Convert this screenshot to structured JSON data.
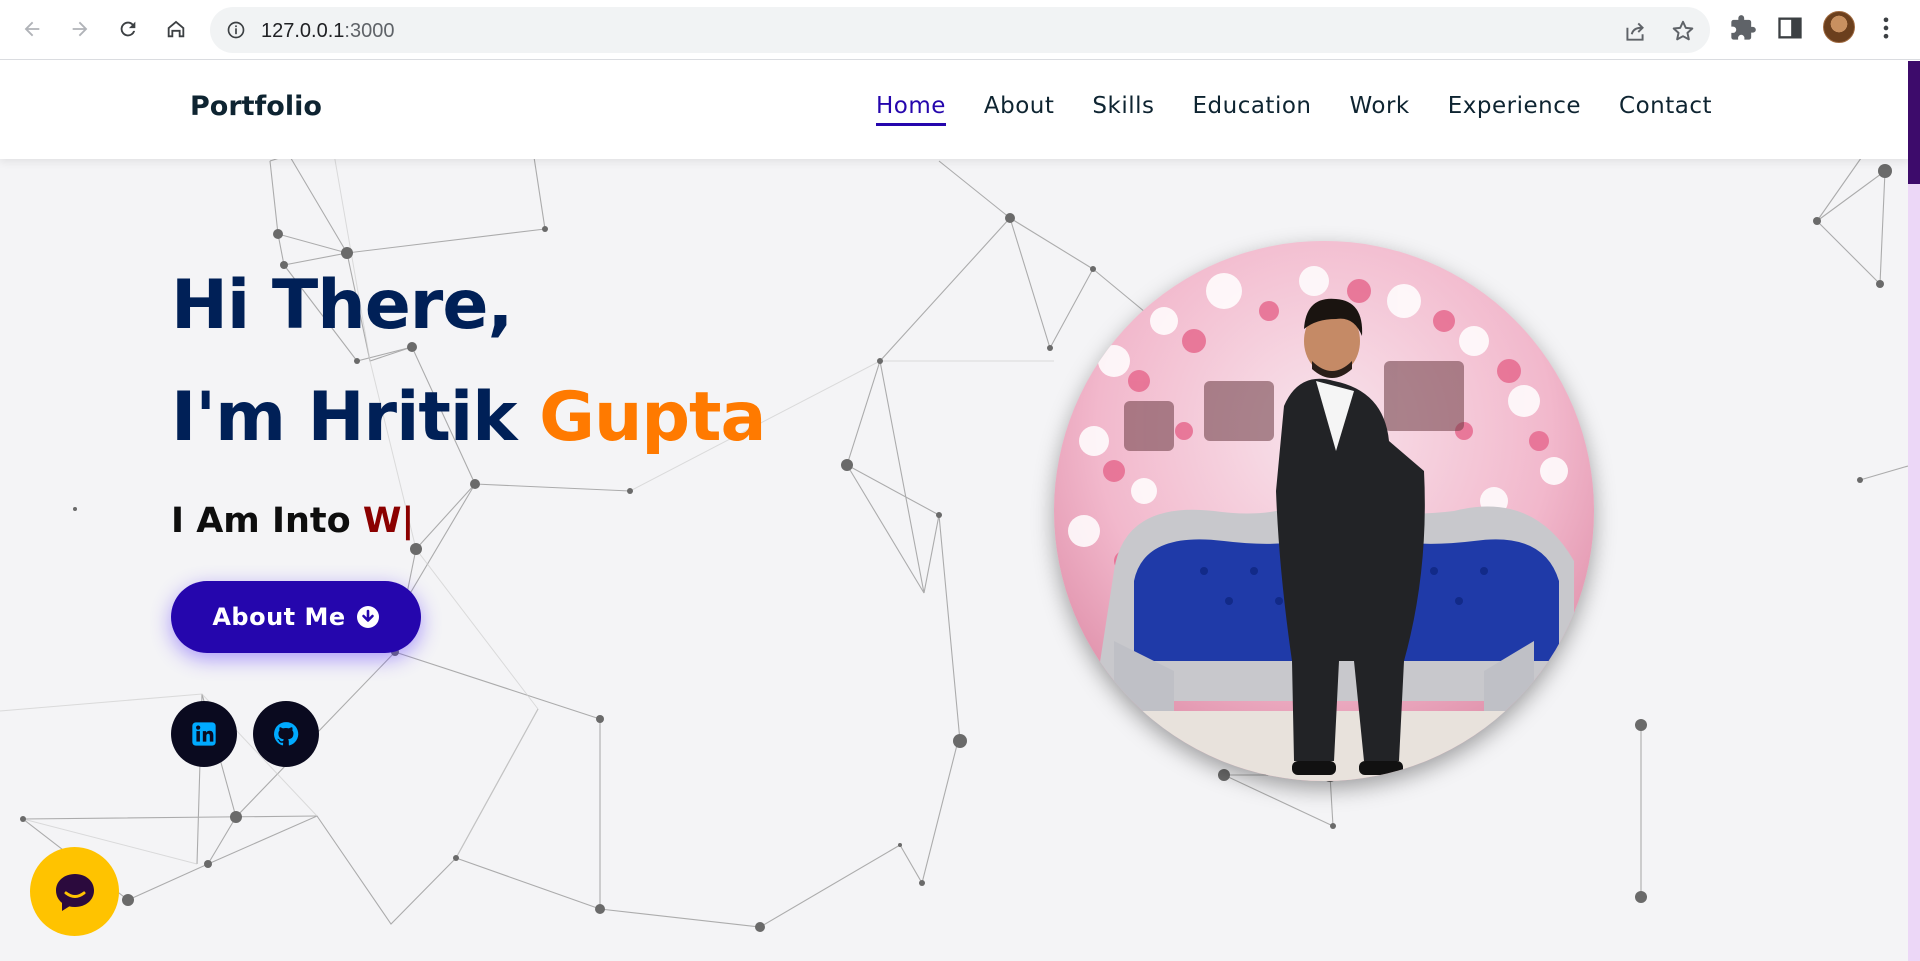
{
  "browser": {
    "url_host": "127.0.0.1",
    "url_port": ":3000"
  },
  "site": {
    "brand": "Portfolio",
    "nav": [
      {
        "label": "Home",
        "active": true
      },
      {
        "label": "About",
        "active": false
      },
      {
        "label": "Skills",
        "active": false
      },
      {
        "label": "Education",
        "active": false
      },
      {
        "label": "Work",
        "active": false
      },
      {
        "label": "Experience",
        "active": false
      },
      {
        "label": "Contact",
        "active": false
      }
    ]
  },
  "hero": {
    "line1": "Hi There,",
    "line2_prefix": "I'm Hritik ",
    "line2_accent": "Gupta",
    "typing_prefix": "I Am Into ",
    "typing_value": "W|",
    "cta_label": "About Me",
    "socials": [
      {
        "name": "linkedin-icon"
      },
      {
        "name": "github-icon"
      }
    ]
  },
  "colors": {
    "brand_text": "#0e2431",
    "nav_active": "#2506ad",
    "title": "#002057",
    "accent_orange": "#ff7a00",
    "typed_text": "#8b0000",
    "cta_bg": "#2506ad",
    "social_bg": "#0a0a1f",
    "social_icon": "#00aaff",
    "chat_bg": "#ffc300",
    "scrollbar_thumb": "#3d0b6b"
  },
  "icons": {
    "back": "arrow-left-icon",
    "forward": "arrow-right-icon",
    "reload": "reload-icon",
    "home": "home-icon",
    "info": "info-icon",
    "share": "share-icon",
    "bookmark": "star-icon",
    "extensions": "puzzle-icon",
    "sidepanel": "side-panel-icon",
    "menu": "kebab-menu-icon",
    "chat": "chat-icon",
    "cta": "arrow-down-circle-icon"
  }
}
